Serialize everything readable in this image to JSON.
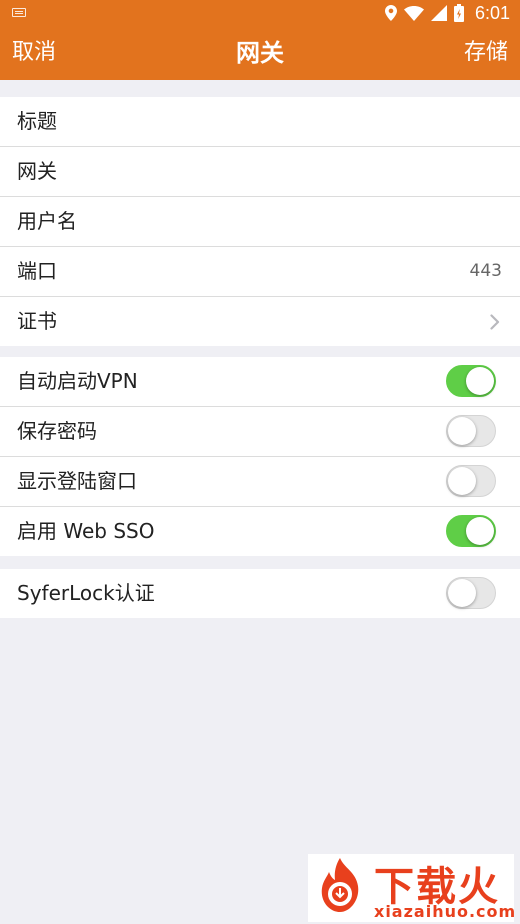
{
  "status_bar": {
    "time": "6:01",
    "icons": [
      "keyboard-icon",
      "location-icon",
      "wifi-icon",
      "signal-icon",
      "battery-icon"
    ]
  },
  "app_bar": {
    "cancel_label": "取消",
    "title": "网关",
    "save_label": "存储"
  },
  "groups": {
    "gateway": {
      "items": [
        {
          "label": "标题"
        },
        {
          "label": "网关"
        },
        {
          "label": "用户名"
        },
        {
          "label": "端口",
          "value": "443"
        },
        {
          "label": "证书",
          "icon": "chevron-right-icon"
        }
      ]
    },
    "options": {
      "items": [
        {
          "label": "自动启动VPN",
          "on": true
        },
        {
          "label": "保存密码",
          "on": false
        },
        {
          "label": "显示登陆窗口",
          "on": false
        },
        {
          "label": "启用 Web SSO",
          "on": true
        }
      ]
    },
    "auth": {
      "items": [
        {
          "label": "SyferLock认证",
          "on": false
        }
      ]
    }
  },
  "watermark": {
    "text": "下载火",
    "url": "xiazaihuo.com"
  },
  "colors": {
    "accent": "#e2731e",
    "toggle_on": "#5fce47",
    "background": "#efeff4",
    "watermark": "#e8401d"
  }
}
